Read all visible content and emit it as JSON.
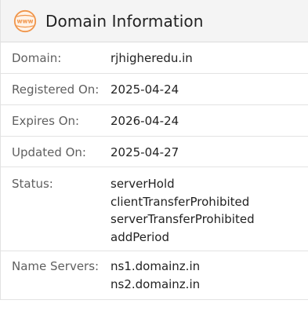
{
  "header": {
    "icon": "www-globe-icon",
    "icon_text": "www",
    "title": "Domain Information"
  },
  "colors": {
    "icon_orange": "#f0954a",
    "header_bg": "#f4f4f4",
    "label_text": "#5f5f5f",
    "value_text": "#222222",
    "divider": "#e3e3e3"
  },
  "rows": [
    {
      "label": "Domain:",
      "values": [
        "rjhigheredu.in"
      ]
    },
    {
      "label": "Registered On:",
      "values": [
        "2025-04-24"
      ]
    },
    {
      "label": "Expires On:",
      "values": [
        "2026-04-24"
      ]
    },
    {
      "label": "Updated On:",
      "values": [
        "2025-04-27"
      ]
    },
    {
      "label": "Status:",
      "values": [
        "serverHold",
        "clientTransferProhibited",
        "serverTransferProhibited",
        "addPeriod"
      ]
    },
    {
      "label": "Name Servers:",
      "values": [
        "ns1.domainz.in",
        "ns2.domainz.in"
      ]
    }
  ]
}
